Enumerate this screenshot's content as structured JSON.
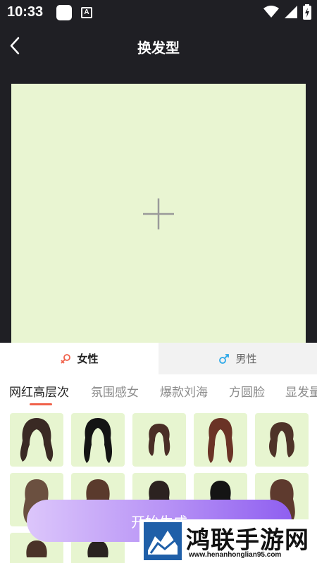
{
  "status_bar": {
    "time": "10:33",
    "a_icon": "A"
  },
  "header": {
    "title": "换发型",
    "back_icon": "chevron-left-icon"
  },
  "upload": {
    "icon": "plus-icon"
  },
  "gender_tabs": [
    {
      "label": "女性",
      "icon": "female-icon",
      "color": "#f0614a",
      "active": true
    },
    {
      "label": "男性",
      "icon": "male-icon",
      "color": "#2aa7e8",
      "active": false
    }
  ],
  "categories": [
    "网红高层次",
    "氛围感女",
    "爆款刘海",
    "方圆脸",
    "显发量"
  ],
  "start_button": {
    "label": "开始生成"
  },
  "watermark": {
    "title": "鸿联手游网",
    "url": "www.henanhonglian95.com"
  },
  "colors": {
    "accent": "#f0614a",
    "tile_bg": "#e7f5d0",
    "upload_bg": "#e9f5d2",
    "button_start": "#dcc6fb",
    "button_end": "#8f5ff0"
  }
}
